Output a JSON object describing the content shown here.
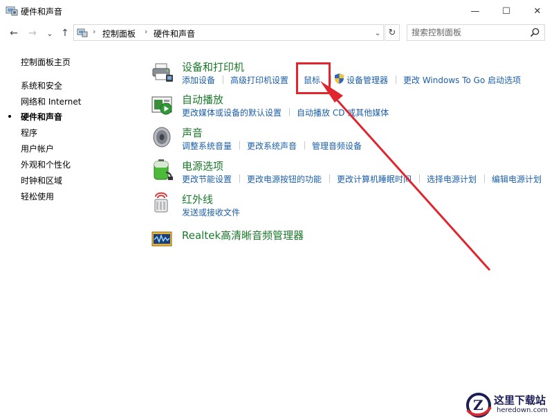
{
  "window": {
    "title": "硬件和声音",
    "minimize_glyph": "—",
    "maximize_glyph": "☐",
    "close_glyph": "✕"
  },
  "nav": {
    "back_glyph": "←",
    "forward_glyph": "→",
    "dropdown_glyph": "⌄",
    "up_glyph": "↑",
    "address_dropdown_glyph": "⌄",
    "refresh_glyph": "↻"
  },
  "breadcrumb": {
    "separator": "›",
    "items": [
      "控制面板",
      "硬件和声音"
    ]
  },
  "search": {
    "placeholder": "搜索控制面板"
  },
  "sidebar": {
    "items": [
      {
        "label": "控制面板主页"
      },
      {
        "label": "系统和安全"
      },
      {
        "label": "网络和 Internet"
      },
      {
        "label": "硬件和声音",
        "current": true
      },
      {
        "label": "程序"
      },
      {
        "label": "用户帐户"
      },
      {
        "label": "外观和个性化"
      },
      {
        "label": "时钟和区域"
      },
      {
        "label": "轻松使用"
      }
    ]
  },
  "categories": [
    {
      "title": "设备和打印机",
      "icon": "printer-icon",
      "tasks": [
        "添加设备",
        "高级打印机设置",
        "鼠标",
        "设备管理器",
        "更改 Windows To Go 启动选项"
      ]
    },
    {
      "title": "自动播放",
      "icon": "autoplay-icon",
      "tasks": [
        "更改媒体或设备的默认设置",
        "自动播放 CD 或其他媒体"
      ]
    },
    {
      "title": "声音",
      "icon": "speaker-icon",
      "tasks": [
        "调整系统音量",
        "更改系统声音",
        "管理音频设备"
      ]
    },
    {
      "title": "电源选项",
      "icon": "battery-icon",
      "tasks": [
        "更改节能设置",
        "更改电源按钮的功能",
        "更改计算机睡眠时间",
        "选择电源计划",
        "编辑电源计划"
      ]
    },
    {
      "title": "红外线",
      "icon": "infrared-icon",
      "tasks": [
        "发送或接收文件"
      ]
    },
    {
      "title": "Realtek高清晰音频管理器",
      "icon": "realtek-audio-icon",
      "tasks": []
    }
  ],
  "colors": {
    "category_title": "#1a7a2a",
    "task_link": "#1b5eab",
    "highlight": "#e0252f"
  },
  "watermark": {
    "title": "这里下载站",
    "url": "heredown.com",
    "logo_letter": "Z"
  }
}
